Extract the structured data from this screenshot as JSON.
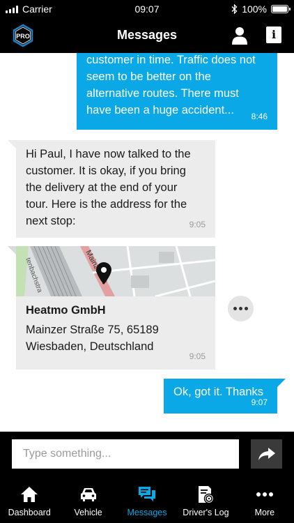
{
  "status_bar": {
    "carrier": "Carrier",
    "time": "09:07",
    "battery": "100%",
    "battery_level": 1.0
  },
  "header": {
    "logo_text": "PRO",
    "title": "Messages"
  },
  "messages": [
    {
      "direction": "outgoing",
      "lines": [
        "customer in time. Traffic does not",
        "seem to be better on the",
        "alternative routes. There must",
        "have been a huge accident..."
      ],
      "time": "8:46"
    },
    {
      "direction": "incoming",
      "lines": [
        "Hi Paul, I have now talked to the",
        "customer. It is okay, if you bring",
        "the delivery at the end of your",
        "tour. Here is the address for the",
        "next stop:"
      ],
      "time": "9:05"
    },
    {
      "direction": "incoming",
      "type": "location",
      "map_street_labels": [
        "Mainzer St",
        "tenbachstra"
      ],
      "name": "Heatmo GmbH",
      "address_lines": [
        "Mainzer Straße 75, 65189",
        "Wiesbaden, Deutschland"
      ],
      "time": "9:05"
    },
    {
      "direction": "outgoing",
      "lines": [
        "Ok, got it. Thanks"
      ],
      "time": "9:07"
    }
  ],
  "composer": {
    "placeholder": "Type something..."
  },
  "tabs": [
    {
      "label": "Dashboard",
      "icon": "home-icon",
      "active": false
    },
    {
      "label": "Vehicle",
      "icon": "car-icon",
      "active": false
    },
    {
      "label": "Messages",
      "icon": "chat-icon",
      "active": true
    },
    {
      "label": "Driver's Log",
      "icon": "log-icon",
      "active": false
    },
    {
      "label": "More",
      "icon": "more-icon",
      "active": false
    }
  ],
  "colors": {
    "accent": "#0aa8e6",
    "incoming_bubble": "#ececec",
    "bar_background": "#000000"
  }
}
